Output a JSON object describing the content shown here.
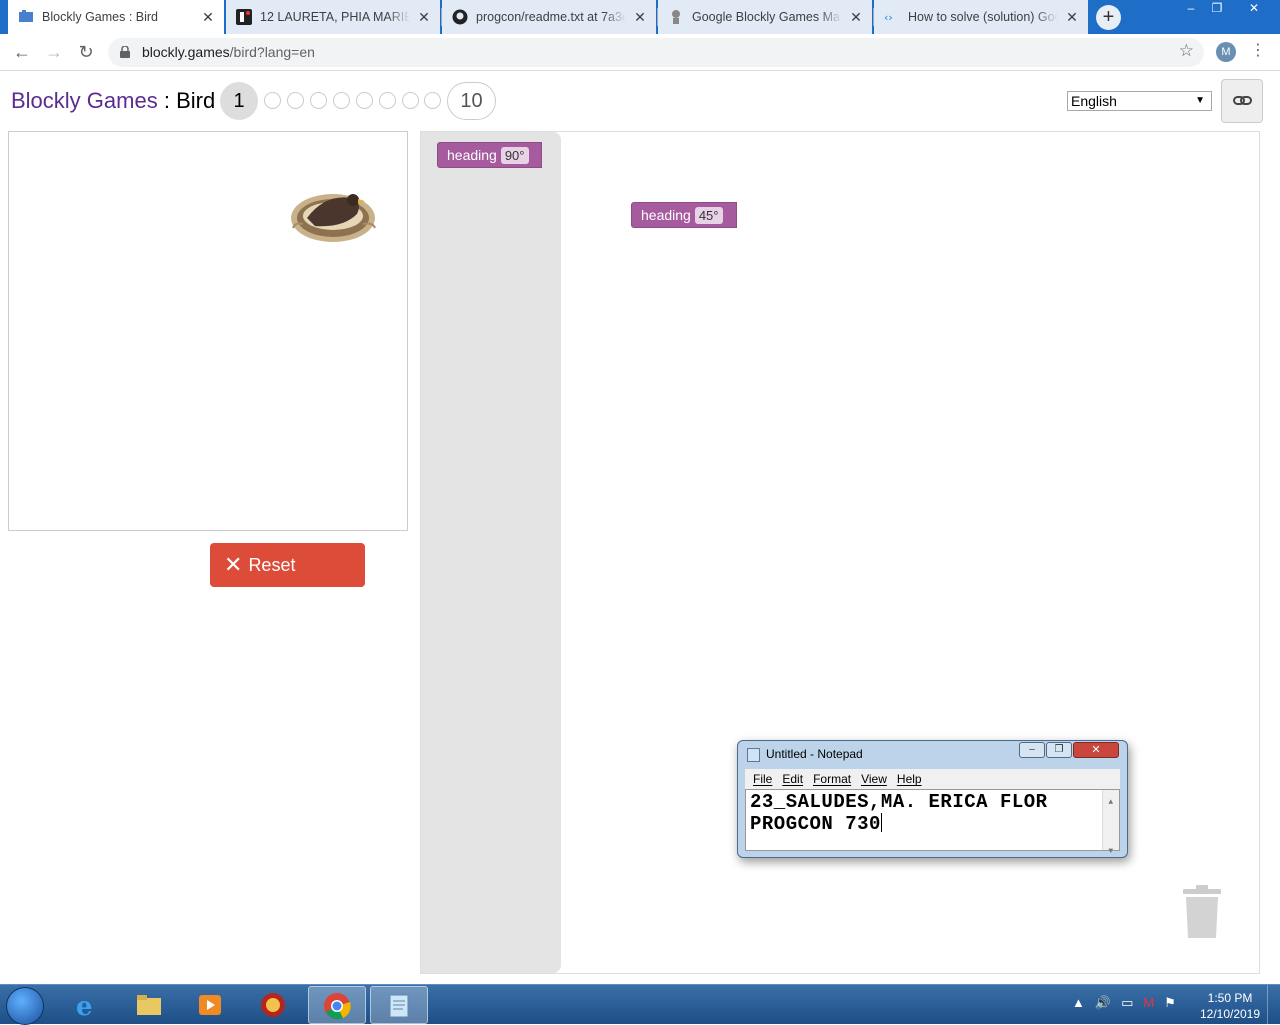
{
  "browser": {
    "tabs": [
      {
        "label": "Blockly Games : Bird",
        "icon": "blockly-favicon",
        "active": true
      },
      {
        "label": "12 LAURETA, PHIA MARIE on",
        "icon": "slides-favicon",
        "active": false
      },
      {
        "label": "progcon/readme.txt at 7a3ed",
        "icon": "github-favicon",
        "active": false
      },
      {
        "label": "Google Blockly Games Maze",
        "icon": "maze-favicon",
        "active": false
      },
      {
        "label": "How to solve (solution) Goog",
        "icon": "link-favicon",
        "active": false
      }
    ],
    "new_tab": "+",
    "window_controls": {
      "minimize": "‒",
      "maximize": "❐",
      "close": "✕"
    },
    "url_host": "blockly.games",
    "url_path": "/bird?lang=en",
    "avatar_letter": "M"
  },
  "page": {
    "title_games": "Blockly Games",
    "title_sep": " : ",
    "title_game": "Bird",
    "current_level": "1",
    "last_level": "10",
    "language": "English",
    "reset_label": "Reset"
  },
  "workspace": {
    "flyout_block": {
      "label": "heading",
      "value": "90°"
    },
    "canvas_block": {
      "label": "heading",
      "value": "45°"
    }
  },
  "notepad": {
    "title": "Untitled - Notepad",
    "menu": [
      "File",
      "Edit",
      "Format",
      "View",
      "Help"
    ],
    "line1": "23_SALUDES,MA. ERICA FLOR",
    "line2": "PROGCON 730"
  },
  "taskbar": {
    "time": "1:50 PM",
    "date": "12/10/2019"
  },
  "colors": {
    "tab_bar": "#1e6dc7",
    "title_purple": "#5c2d91",
    "reset_red": "#dd4b39",
    "block_purple": "#a55b9e"
  }
}
